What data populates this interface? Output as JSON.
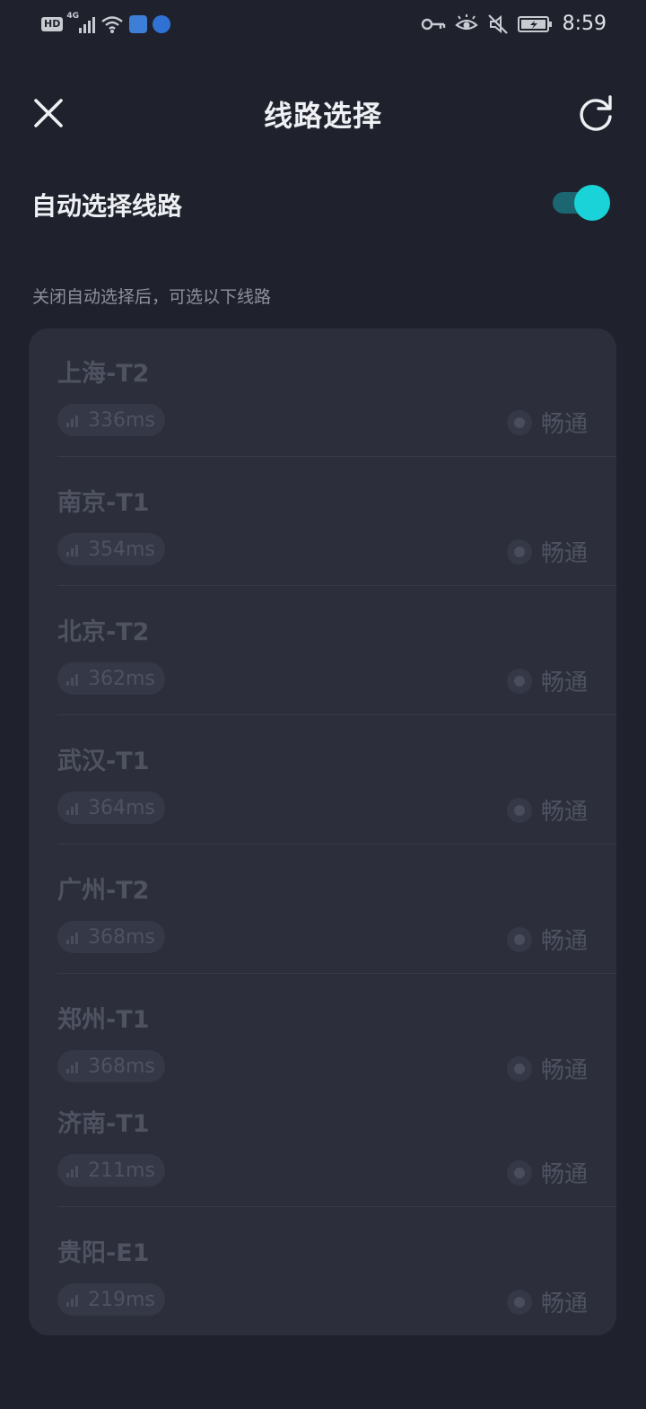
{
  "status_bar": {
    "hd_label": "HD",
    "network_label": "4G",
    "time": "8:59",
    "icons": [
      "hd-icon",
      "cellular-signal-icon",
      "wifi-icon",
      "app-notification-icon",
      "globe-notification-icon",
      "vpn-key-icon",
      "eye-comfort-icon",
      "mute-icon",
      "battery-charging-icon"
    ]
  },
  "header": {
    "title": "线路选择",
    "close_icon": "close-icon",
    "refresh_icon": "refresh-icon"
  },
  "auto_select": {
    "label": "自动选择线路",
    "enabled": true
  },
  "hint": "关闭自动选择后，可选以下线路",
  "lines": [
    {
      "name": "上海-T2",
      "latency": "336ms",
      "status": "畅通"
    },
    {
      "name": "南京-T1",
      "latency": "354ms",
      "status": "畅通"
    },
    {
      "name": "北京-T2",
      "latency": "362ms",
      "status": "畅通"
    },
    {
      "name": "武汉-T1",
      "latency": "364ms",
      "status": "畅通"
    },
    {
      "name": "广州-T2",
      "latency": "368ms",
      "status": "畅通"
    },
    {
      "name": "郑州-T1",
      "latency": "368ms",
      "status": "畅通"
    },
    {
      "name": "济南-T1",
      "latency": "211ms",
      "status": "畅通"
    },
    {
      "name": "贵阳-E1",
      "latency": "219ms",
      "status": "畅通"
    }
  ],
  "colors": {
    "background": "#1f222c",
    "card": "#2c2f3b",
    "accent": "#19d3d8",
    "disabled_text": "#4e5261"
  }
}
